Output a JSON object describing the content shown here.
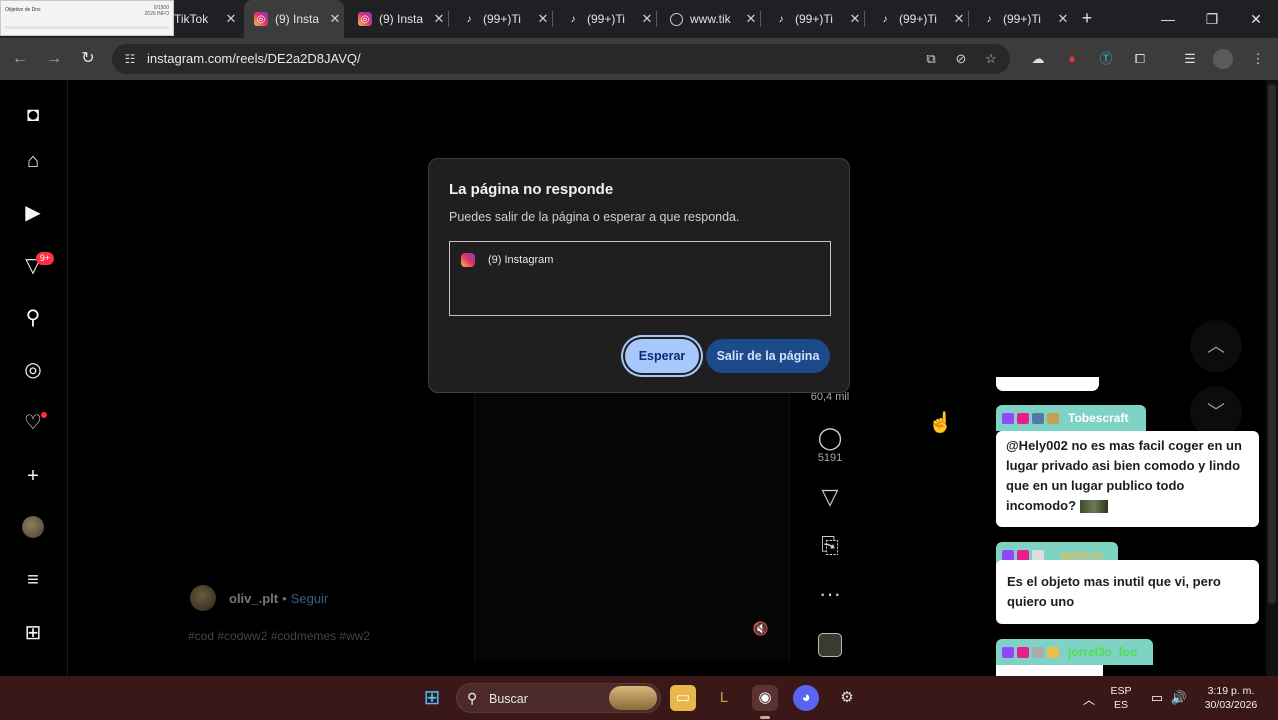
{
  "window_thumb": {
    "title": "Objetivo de Dns",
    "line1": "0/1500",
    "line2": "2026 INFO"
  },
  "tabs": [
    {
      "title": "TikTok",
      "icon": "tiktok-icon",
      "active": false
    },
    {
      "title": "(9) Insta",
      "icon": "instagram-icon",
      "active": true
    },
    {
      "title": "(9) Insta",
      "icon": "instagram-icon",
      "active": false
    },
    {
      "title": "(99+)Ti",
      "icon": "tiktok-icon",
      "active": false
    },
    {
      "title": "(99+)Ti",
      "icon": "tiktok-icon",
      "active": false
    },
    {
      "title": "www.tik",
      "icon": "globe-icon",
      "active": false
    },
    {
      "title": "(99+)Ti",
      "icon": "tiktok-icon",
      "active": false
    },
    {
      "title": "(99+)Ti",
      "icon": "tiktok-icon",
      "active": false
    },
    {
      "title": "(99+)Ti",
      "icon": "tiktok-icon",
      "active": false
    }
  ],
  "toolbar": {
    "url": "instagram.com/reels/DE2a2D8JAVQ/"
  },
  "sidebar": {
    "notif_badge": "9+"
  },
  "reel": {
    "likes": "60,4 mil",
    "comments": "5191",
    "author": "oliv_.plt",
    "separator": "•",
    "follow": "Seguir",
    "hashtags": "#cod #codww2 #codmemes #ww2"
  },
  "dialog": {
    "title": "La página no responde",
    "message": "Puedes salir de la página o esperar a que responda.",
    "page_item": "(9) Instagram",
    "wait_label": "Esperar",
    "leave_label": "Salir de la página"
  },
  "chat": [
    {
      "user": "Tobescraft",
      "user_color": "#ffffff",
      "head_color": "#7fd3c4",
      "text": "@Hely002 no es mas facil coger en un lugar privado asi bien comodo y lindo que en un lugar publico todo incomodo?"
    },
    {
      "user": "_xprincs_",
      "user_color": "#f0b84e",
      "head_color": "#7fd3c4",
      "text": "Es el objeto mas inutil que vi, pero quiero uno"
    },
    {
      "user": "jorrel3o_foo",
      "user_color": "#4ee04e",
      "head_color": "#7fd3c4",
      "text": ""
    }
  ],
  "taskbar": {
    "search_label": "Buscar",
    "lang_top": "ESP",
    "lang_bottom": "ES",
    "time": "3:19 p. m.",
    "date": "30/03/2026"
  },
  "colors": {
    "accent_button": "#a8c7fa",
    "instagram_badge": "#ff3040",
    "taskbar": "#3a1818"
  }
}
